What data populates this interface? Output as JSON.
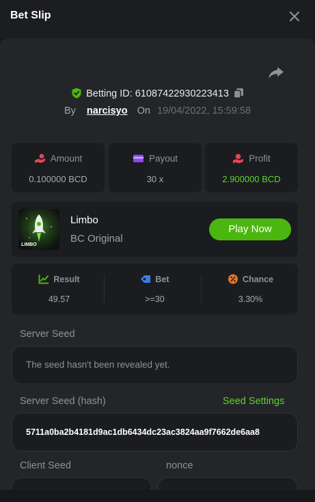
{
  "header": {
    "title": "Bet Slip"
  },
  "bet": {
    "id_label": "Betting ID: 61087422930223413",
    "by_label": "By",
    "user": "narcisyo",
    "on_label": "On",
    "date": "19/04/2022, 15:59:58"
  },
  "stats": [
    {
      "label": "Amount",
      "value": "0.100000 BCD",
      "icon": "money-hand-icon"
    },
    {
      "label": "Payout",
      "value": "30 x",
      "icon": "wallet-icon"
    },
    {
      "label": "Profit",
      "value": "2.900000 BCD",
      "icon": "profit-icon"
    }
  ],
  "game": {
    "thumb_label": "LIMBO",
    "name": "Limbo",
    "subtitle": "BC Original",
    "play_label": "Play Now"
  },
  "results": [
    {
      "label": "Result",
      "value": "49.57",
      "icon": "result-chart-icon"
    },
    {
      "label": "Bet",
      "value": ">=30",
      "icon": "bet-tag-icon"
    },
    {
      "label": "Chance",
      "value": "3.30%",
      "icon": "percent-icon"
    }
  ],
  "server_seed": {
    "label": "Server Seed",
    "value": "The seed hasn't been revealed yet."
  },
  "server_seed_hash": {
    "label": "Server Seed (hash)",
    "settings_link": "Seed Settings",
    "value": "5711a0ba2b4181d9ac1db6434dc23ac3824aa9f7662de6aa8"
  },
  "client_seed": {
    "label": "Client Seed",
    "value": ""
  },
  "nonce": {
    "label": "nonce",
    "value": ""
  },
  "colors": {
    "accent": "#4bb60f",
    "green_text": "#5fd42d",
    "panel": "#232529",
    "card": "#1b1c20"
  }
}
